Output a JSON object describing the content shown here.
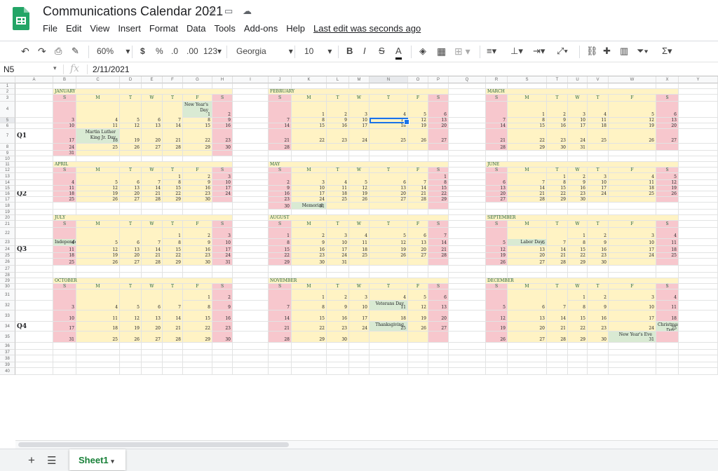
{
  "app": {
    "title": "Communications Calendar 2021",
    "menu": [
      "File",
      "Edit",
      "View",
      "Insert",
      "Format",
      "Data",
      "Tools",
      "Add-ons",
      "Help"
    ],
    "last_edit": "Last edit was seconds ago"
  },
  "toolbar": {
    "zoom": "60%",
    "currency": "$",
    "percent": "%",
    "dec_less": ".0",
    "dec_more": ".00",
    "format_more": "123",
    "font": "Georgia",
    "font_size": "10"
  },
  "formula_bar": {
    "cell_ref": "N5",
    "value": "2/11/2021"
  },
  "columns": [
    "A",
    "B",
    "C",
    "D",
    "E",
    "F",
    "G",
    "H",
    "I",
    "J",
    "K",
    "L",
    "M",
    "N",
    "O",
    "P",
    "Q",
    "R",
    "S",
    "T",
    "U",
    "V",
    "W",
    "X",
    "Y"
  ],
  "rows": [
    "1",
    "2",
    "3",
    "4",
    "5",
    "6",
    "7",
    "8",
    "9",
    "10",
    "11",
    "12",
    "13",
    "14",
    "15",
    "16",
    "17",
    "18",
    "19",
    "20",
    "21",
    "22",
    "23",
    "24",
    "25",
    "26",
    "27",
    "28",
    "29",
    "30",
    "31",
    "32",
    "33",
    "34",
    "35",
    "36",
    "37",
    "38",
    "39",
    "40"
  ],
  "weekdays": [
    "S",
    "M",
    "T",
    "W",
    "T",
    "F",
    "S"
  ],
  "quarters": [
    "Q1",
    "Q2",
    "Q3",
    "Q4"
  ],
  "months": [
    "JANUARY",
    "FEBRUARY",
    "MARCH",
    "APRIL",
    "MAY",
    "JUNE",
    "JULY",
    "AUGUST",
    "SEPTEMBER",
    "OCTOBER",
    "NOVEMBER",
    "DECEMBER"
  ],
  "events": {
    "new_years_day": "New Year's Day",
    "mlk_day": "Martin Luther King Jr. Day",
    "memorial_day": "Memorial Day",
    "independence_day": "Independence Day",
    "labor_day": "Labor Day",
    "veterans_day": "Veterans Day",
    "thanksgiving": "Thanksgiving",
    "christmas_day": "Christmas Day",
    "new_years_eve": "New Year's Eve"
  },
  "sheet": {
    "tab_name": "Sheet1"
  },
  "colors": {
    "yellow": "#fff3c4",
    "pink": "#f7c7cd",
    "green": "#d9ead3",
    "accent": "#1a73e8"
  }
}
